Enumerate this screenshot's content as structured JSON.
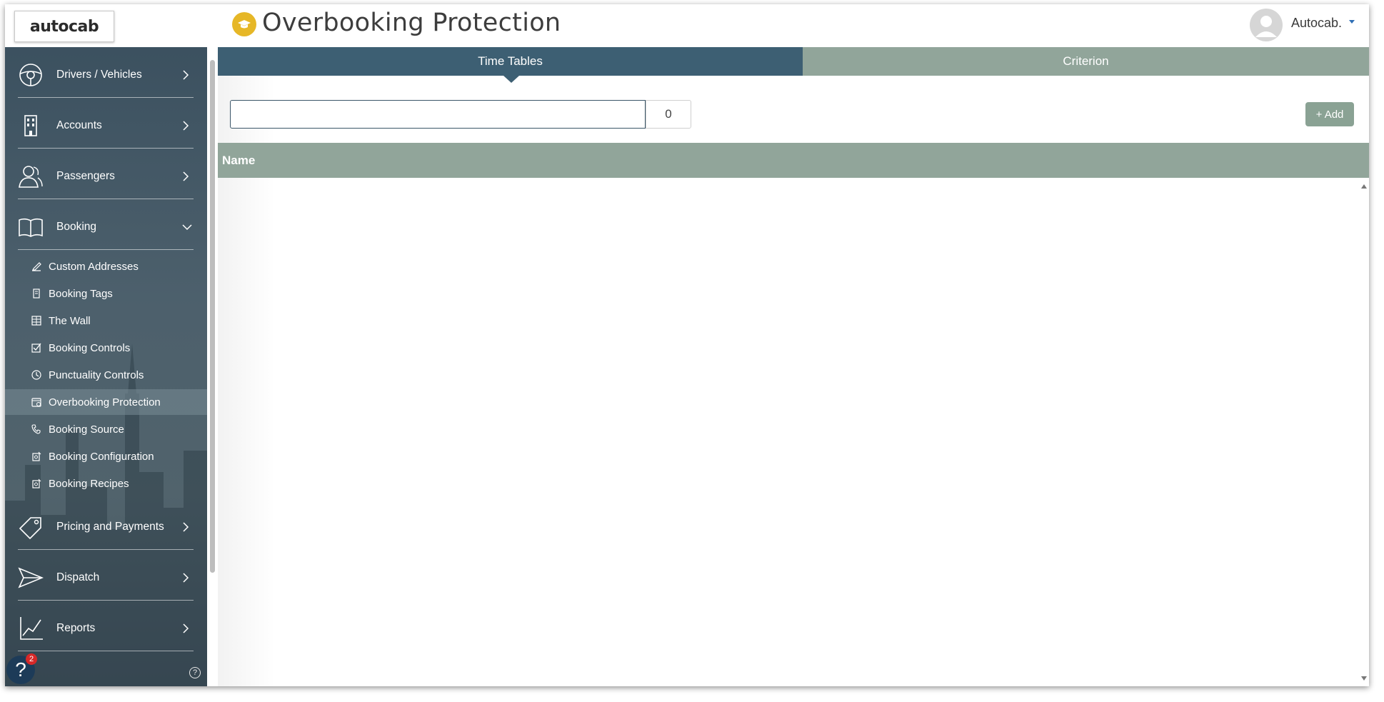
{
  "brand": {
    "logo_text": "autocab"
  },
  "header": {
    "title": "Overbooking Protection",
    "title_icon": "graduation-cap-icon",
    "user_name": "Autocab."
  },
  "sidebar": {
    "main_items": [
      {
        "label": "Drivers / Vehicles",
        "icon": "steering-wheel-icon",
        "expanded": false
      },
      {
        "label": "Accounts",
        "icon": "building-icon",
        "expanded": false
      },
      {
        "label": "Passengers",
        "icon": "users-icon",
        "expanded": false
      },
      {
        "label": "Booking",
        "icon": "book-icon",
        "expanded": true
      },
      {
        "label": "Pricing and Payments",
        "icon": "tag-icon",
        "expanded": false
      },
      {
        "label": "Dispatch",
        "icon": "paper-plane-icon",
        "expanded": false
      },
      {
        "label": "Reports",
        "icon": "line-chart-icon",
        "expanded": false
      }
    ],
    "booking_sub_items": [
      {
        "label": "Custom Addresses",
        "icon": "edit-icon"
      },
      {
        "label": "Booking Tags",
        "icon": "tag-doc-icon"
      },
      {
        "label": "The Wall",
        "icon": "grid-icon"
      },
      {
        "label": "Booking Controls",
        "icon": "check-square-icon"
      },
      {
        "label": "Punctuality Controls",
        "icon": "clock-icon"
      },
      {
        "label": "Overbooking Protection",
        "icon": "calendar-icon",
        "active": true
      },
      {
        "label": "Booking Source",
        "icon": "phone-icon"
      },
      {
        "label": "Booking Configuration",
        "icon": "config-doc-icon"
      },
      {
        "label": "Booking Recipes",
        "icon": "recipe-doc-icon"
      }
    ],
    "help_badge_count": "2",
    "help_label": "?",
    "small_help_label": "?"
  },
  "tabs": [
    {
      "label": "Time Tables",
      "active": true
    },
    {
      "label": "Criterion",
      "active": false
    }
  ],
  "toolbar": {
    "search_value": "",
    "count": "0",
    "add_label": "+ Add"
  },
  "table": {
    "columns": [
      "Name"
    ],
    "rows": []
  },
  "colors": {
    "tab_active": "#3d5f73",
    "tab_inactive": "#91a59a",
    "accent_yellow": "#e6b727",
    "badge_red": "#d72828"
  }
}
